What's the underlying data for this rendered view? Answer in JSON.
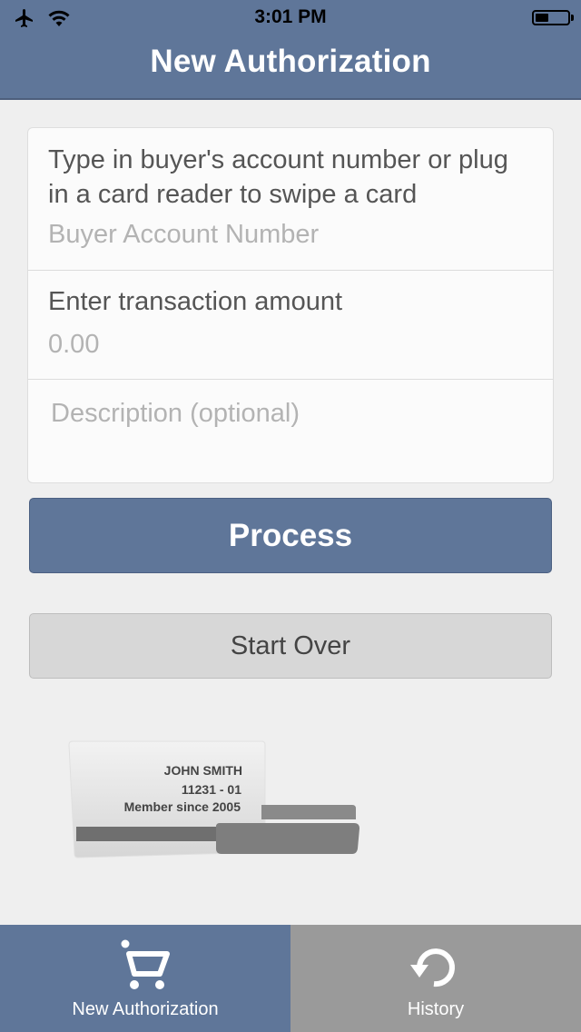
{
  "status_bar": {
    "time": "3:01 PM"
  },
  "header": {
    "title": "New Authorization"
  },
  "form": {
    "account_prompt": "Type in buyer's account number or plug in a card reader to swipe a card",
    "account_placeholder": "Buyer Account Number",
    "amount_prompt": "Enter transaction amount",
    "amount_placeholder": "0.00",
    "description_placeholder": "Description (optional)"
  },
  "buttons": {
    "process": "Process",
    "start_over": "Start Over"
  },
  "card": {
    "name": "JOHN SMITH",
    "number": "11231 - 01",
    "member_since": "Member since 2005"
  },
  "tabs": [
    {
      "label": "New Authorization",
      "icon": "cart-icon",
      "selected": true
    },
    {
      "label": "History",
      "icon": "history-icon",
      "selected": false
    }
  ],
  "colors": {
    "primary": "#5f7699",
    "background": "#efefef",
    "tab_inactive": "#9a9a9a"
  }
}
